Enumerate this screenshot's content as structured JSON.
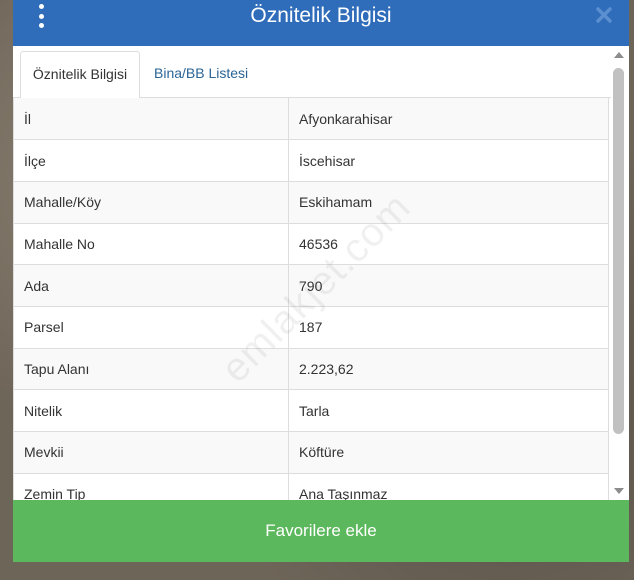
{
  "header": {
    "title": "Öznitelik Bilgisi",
    "menu_icon": "kebab-menu-icon",
    "close_icon": "close-icon"
  },
  "tabs": [
    {
      "label": "Öznitelik Bilgisi",
      "active": true
    },
    {
      "label": "Bina/BB Listesi",
      "active": false
    }
  ],
  "attributes": [
    {
      "key": "İl",
      "value": "Afyonkarahisar"
    },
    {
      "key": "İlçe",
      "value": "İscehisar"
    },
    {
      "key": "Mahalle/Köy",
      "value": "Eskihamam"
    },
    {
      "key": "Mahalle No",
      "value": "46536"
    },
    {
      "key": "Ada",
      "value": "790"
    },
    {
      "key": "Parsel",
      "value": "187"
    },
    {
      "key": "Tapu Alanı",
      "value": "2.223,62"
    },
    {
      "key": "Nitelik",
      "value": "Tarla"
    },
    {
      "key": "Mevkii",
      "value": "Köftüre"
    },
    {
      "key": "Zemin Tip",
      "value": "Ana Taşınmaz"
    }
  ],
  "footer": {
    "button_label": "Favorilere ekle"
  },
  "watermark": "emlakjet.com",
  "colors": {
    "header_bg": "#2f6dba",
    "button_bg": "#5cb85c",
    "tab_link": "#2a6496"
  }
}
